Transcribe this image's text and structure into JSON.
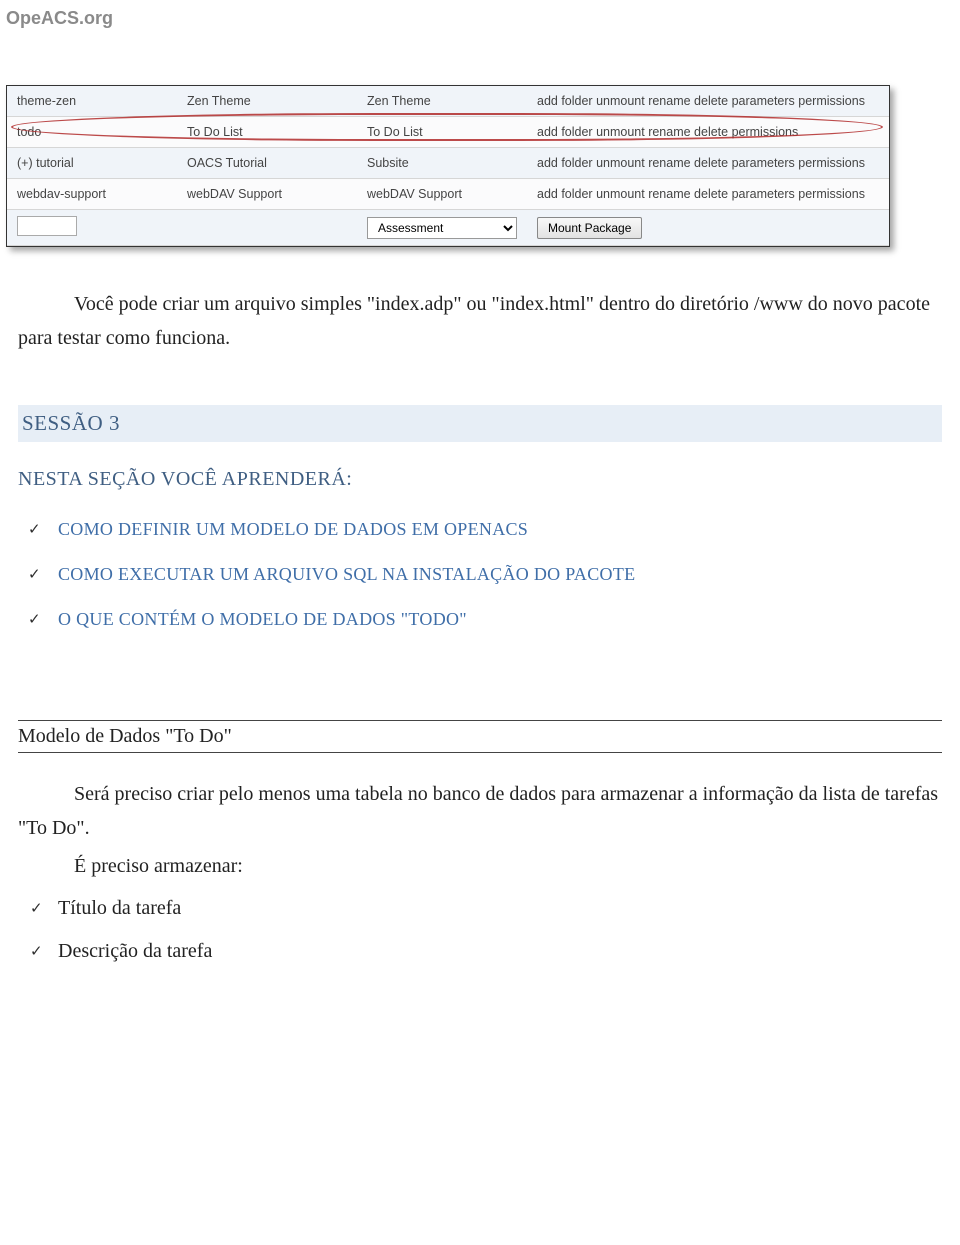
{
  "site": {
    "title": "OpeACS.org"
  },
  "table": {
    "rows": [
      {
        "path": "theme-zen",
        "name": "Zen Theme",
        "type": "Zen Theme",
        "actions": "add folder unmount rename delete parameters permissions"
      },
      {
        "path": "todo",
        "name": "To Do List",
        "type": "To Do List",
        "actions": "add folder unmount rename delete permissions"
      },
      {
        "path": "(+) tutorial",
        "name": "OACS Tutorial",
        "type": "Subsite",
        "actions": "add folder unmount rename delete parameters permissions"
      },
      {
        "path": "webdav-support",
        "name": "webDAV Support",
        "type": "webDAV Support",
        "actions": "add folder unmount rename delete parameters permissions"
      }
    ],
    "select_value": "Assessment",
    "mount_label": "Mount Package"
  },
  "intro": "Você pode criar um arquivo simples \"index.adp\" ou \"index.html\" dentro do diretório /www do novo pacote para testar como funciona.",
  "session": {
    "heading": "SESSÃO 3",
    "subhead": "NESTA SEÇÃO VOCÊ APRENDERÁ:",
    "goals": [
      "COMO DEFINIR UM MODELO DE DADOS EM OPENACS",
      "COMO EXECUTAR UM ARQUIVO SQL NA INSTALAÇÃO DO PACOTE",
      "O QUE CONTÉM O MODELO DE DADOS \"TODO\""
    ]
  },
  "section": {
    "title": "Modelo de Dados \"To Do\"",
    "p1": "Será preciso criar pelo menos uma tabela no banco de dados para armazenar a informação da lista de tarefas \"To Do\".",
    "p2": "É preciso armazenar:",
    "items": [
      "Título da tarefa",
      "Descrição da tarefa"
    ]
  }
}
